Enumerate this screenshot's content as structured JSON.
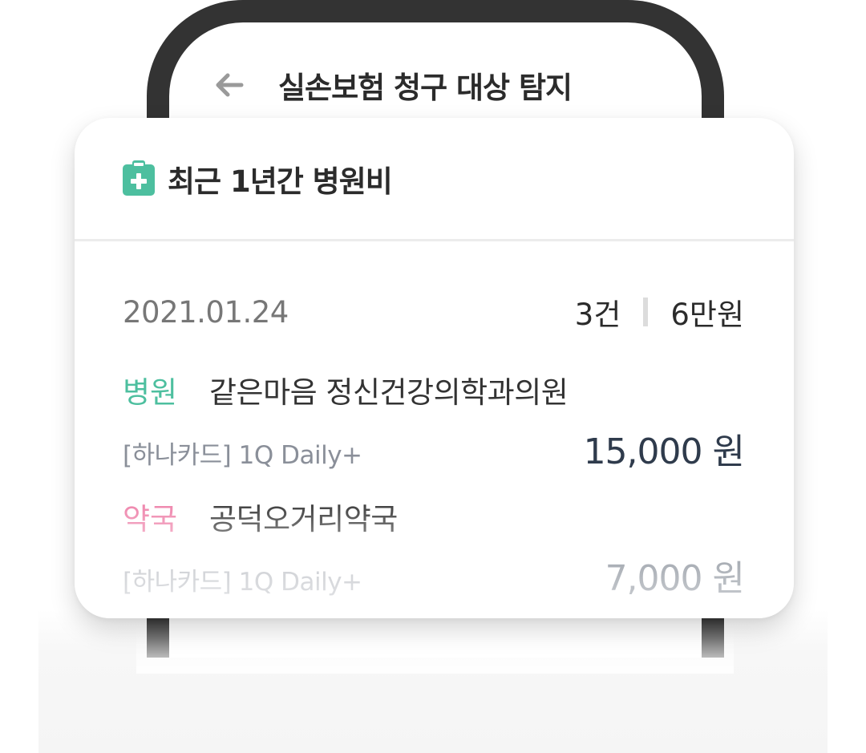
{
  "app": {
    "title": "실손보험 청구 대상 탐지",
    "back_icon": "arrow-left-icon"
  },
  "card": {
    "icon": "medical-clipboard-icon",
    "title": "최근 1년간 병원비",
    "date": "2021.01.24",
    "count": "3건",
    "total": "6만원",
    "entries": [
      {
        "kind": "병원",
        "place": "같은마음 정신건강의학과의원",
        "card_name": "[하나카드] 1Q Daily+",
        "amount": "15,000 원"
      },
      {
        "kind": "약국",
        "place": "공덕오거리약국",
        "card_name": "[하나카드] 1Q Daily+",
        "amount": "7,000 원"
      }
    ]
  },
  "colors": {
    "hospital_label": "#4dbf9f",
    "pharmacy_label": "#ee7fa8",
    "icon_teal": "#4dbf9f",
    "frame": "#333333"
  }
}
